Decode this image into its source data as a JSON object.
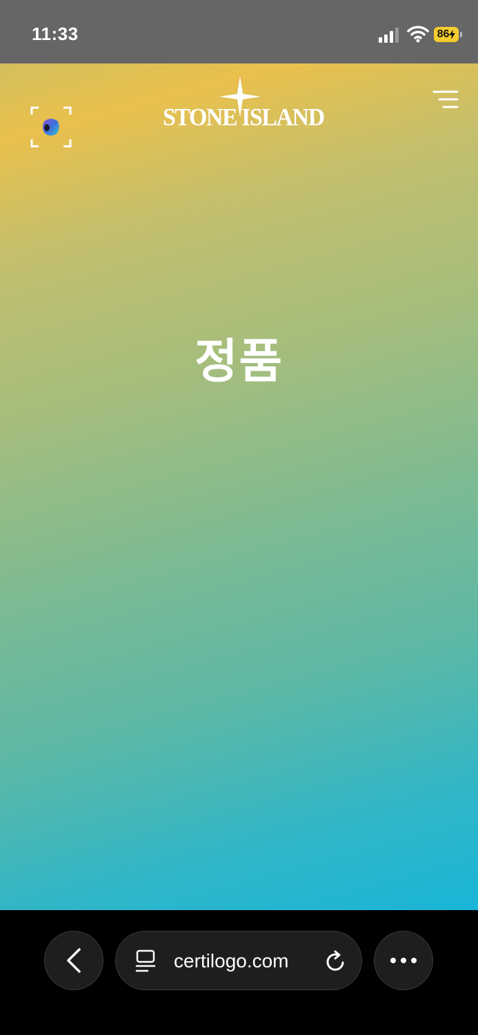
{
  "status_bar": {
    "time": "11:33",
    "battery_level": "86"
  },
  "header": {
    "brand_name": "STONE ISLAND",
    "scan_icon": "scan-camera-icon",
    "menu_icon": "menu-icon"
  },
  "main": {
    "authentication_result": "정품"
  },
  "browser": {
    "url": "certilogo.com",
    "back_icon": "chevron-left-icon",
    "reader_icon": "reader-icon",
    "reload_icon": "reload-icon",
    "more_icon": "more-icon"
  },
  "colors": {
    "gradient_top": "#e9c04d",
    "gradient_bottom": "#1ab5d8",
    "battery": "#f5cc2d"
  }
}
